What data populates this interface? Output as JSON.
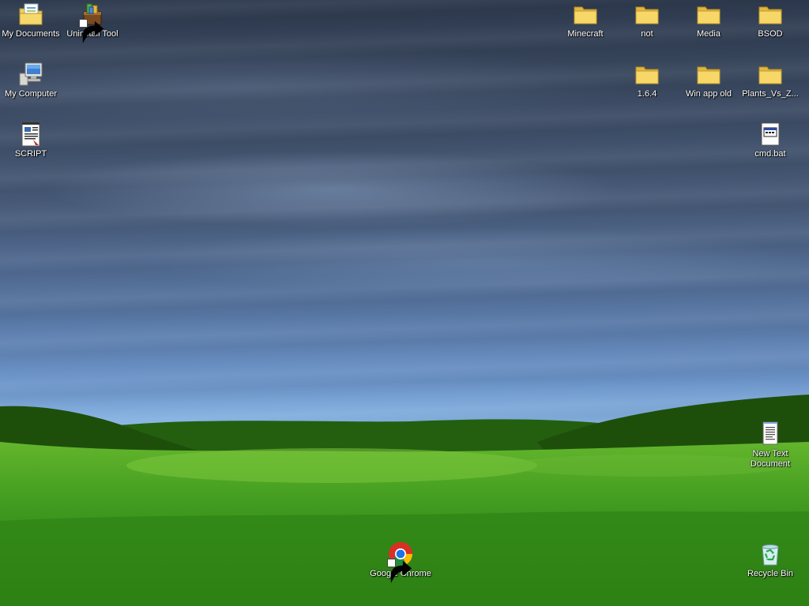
{
  "desktop": {
    "icons": {
      "my_documents": {
        "label": "My Documents",
        "icon": "my-documents-icon"
      },
      "uninstall_tool": {
        "label": "Uninstall Tool",
        "icon": "uninstall-tool-icon"
      },
      "my_computer": {
        "label": "My Computer",
        "icon": "computer-icon"
      },
      "script": {
        "label": "SCRIPT",
        "icon": "script-document-icon"
      },
      "minecraft": {
        "label": "Minecraft",
        "icon": "folder-icon"
      },
      "not": {
        "label": "not",
        "icon": "folder-icon"
      },
      "media": {
        "label": "Media",
        "icon": "folder-icon"
      },
      "bsod": {
        "label": "BSOD",
        "icon": "folder-icon"
      },
      "v164": {
        "label": "1.6.4",
        "icon": "folder-icon"
      },
      "win_app_old": {
        "label": "Win app old",
        "icon": "folder-icon"
      },
      "plants": {
        "label": "Plants_Vs_Z...",
        "icon": "folder-icon"
      },
      "cmd_bat": {
        "label": "cmd.bat",
        "icon": "batch-file-icon"
      },
      "new_text": {
        "label": "New Text\nDocument",
        "icon": "text-document-icon"
      },
      "chrome": {
        "label": "Google Chrome",
        "icon": "chrome-icon"
      },
      "recycle_bin": {
        "label": "Recycle Bin",
        "icon": "recycle-bin-icon"
      }
    },
    "colors": {
      "sky_top": "#2e3a4e",
      "sky_horizon": "#9ccaf0",
      "grass": "#3f9a1f",
      "folder": "#f4d35e",
      "label_text": "#ffffff"
    }
  }
}
